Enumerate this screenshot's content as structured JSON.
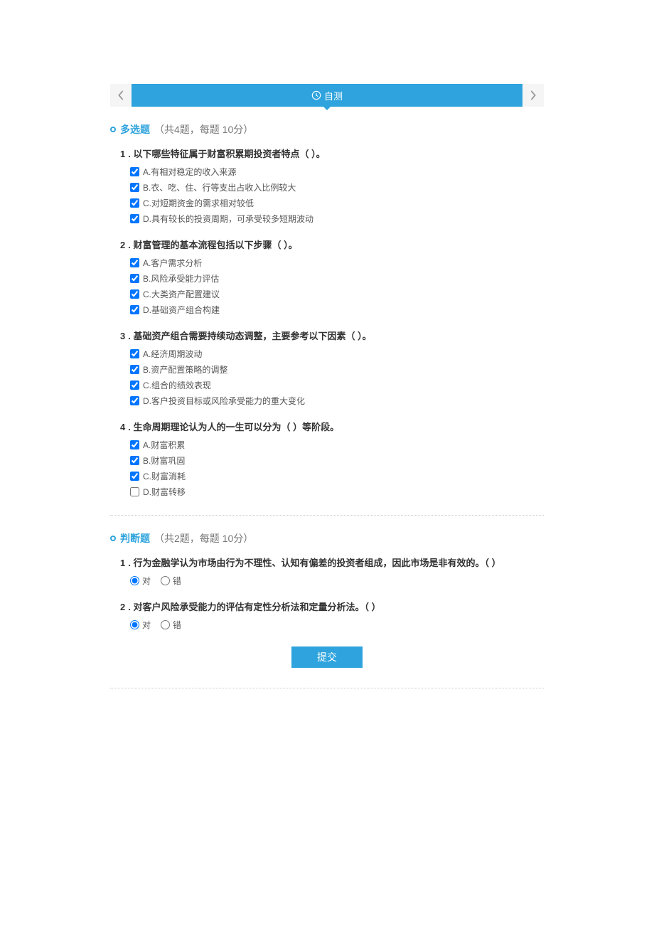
{
  "header": {
    "title": "自测"
  },
  "sections": [
    {
      "name": "多选题",
      "sub": "（共4题，每题 10分）",
      "questions": [
        {
          "num": "1",
          "text": "以下哪些特征属于财富积累期投资者特点（ ）。",
          "options": [
            {
              "label": "A.有相对稳定的收入来源",
              "checked": true
            },
            {
              "label": "B.衣、吃、住、行等支出占收入比例较大",
              "checked": true
            },
            {
              "label": "C.对短期资金的需求相对较低",
              "checked": true
            },
            {
              "label": "D.具有较长的投资周期，可承受较多短期波动",
              "checked": true
            }
          ]
        },
        {
          "num": "2",
          "text": "财富管理的基本流程包括以下步骤（ ）。",
          "options": [
            {
              "label": "A.客户需求分析",
              "checked": true
            },
            {
              "label": "B.风险承受能力评估",
              "checked": true
            },
            {
              "label": "C.大类资产配置建议",
              "checked": true
            },
            {
              "label": "D.基础资产组合构建",
              "checked": true
            }
          ]
        },
        {
          "num": "3",
          "text": "基础资产组合需要持续动态调整，主要参考以下因素（ ）。",
          "options": [
            {
              "label": "A.经济周期波动",
              "checked": true
            },
            {
              "label": "B.资产配置策略的调整",
              "checked": true
            },
            {
              "label": "C.组合的绩效表现",
              "checked": true
            },
            {
              "label": "D.客户投资目标或风险承受能力的重大变化",
              "checked": true
            }
          ]
        },
        {
          "num": "4",
          "text": "生命周期理论认为人的一生可以分为（ ）等阶段。",
          "options": [
            {
              "label": "A.财富积累",
              "checked": true
            },
            {
              "label": "B.财富巩固",
              "checked": true
            },
            {
              "label": "C.财富消耗",
              "checked": true
            },
            {
              "label": "D.财富转移",
              "checked": false
            }
          ]
        }
      ]
    },
    {
      "name": "判断题",
      "sub": "（共2题，每题 10分）",
      "questions": [
        {
          "num": "1",
          "text": "行为金融学认为市场由行为不理性、认知有偏差的投资者组成，因此市场是非有效的。（ ）",
          "radios": {
            "true_label": "对",
            "false_label": "错",
            "selected": "true"
          }
        },
        {
          "num": "2",
          "text": "对客户风险承受能力的评估有定性分析法和定量分析法。（ ）",
          "radios": {
            "true_label": "对",
            "false_label": "错",
            "selected": "true"
          }
        }
      ]
    }
  ],
  "submit_label": "提交"
}
